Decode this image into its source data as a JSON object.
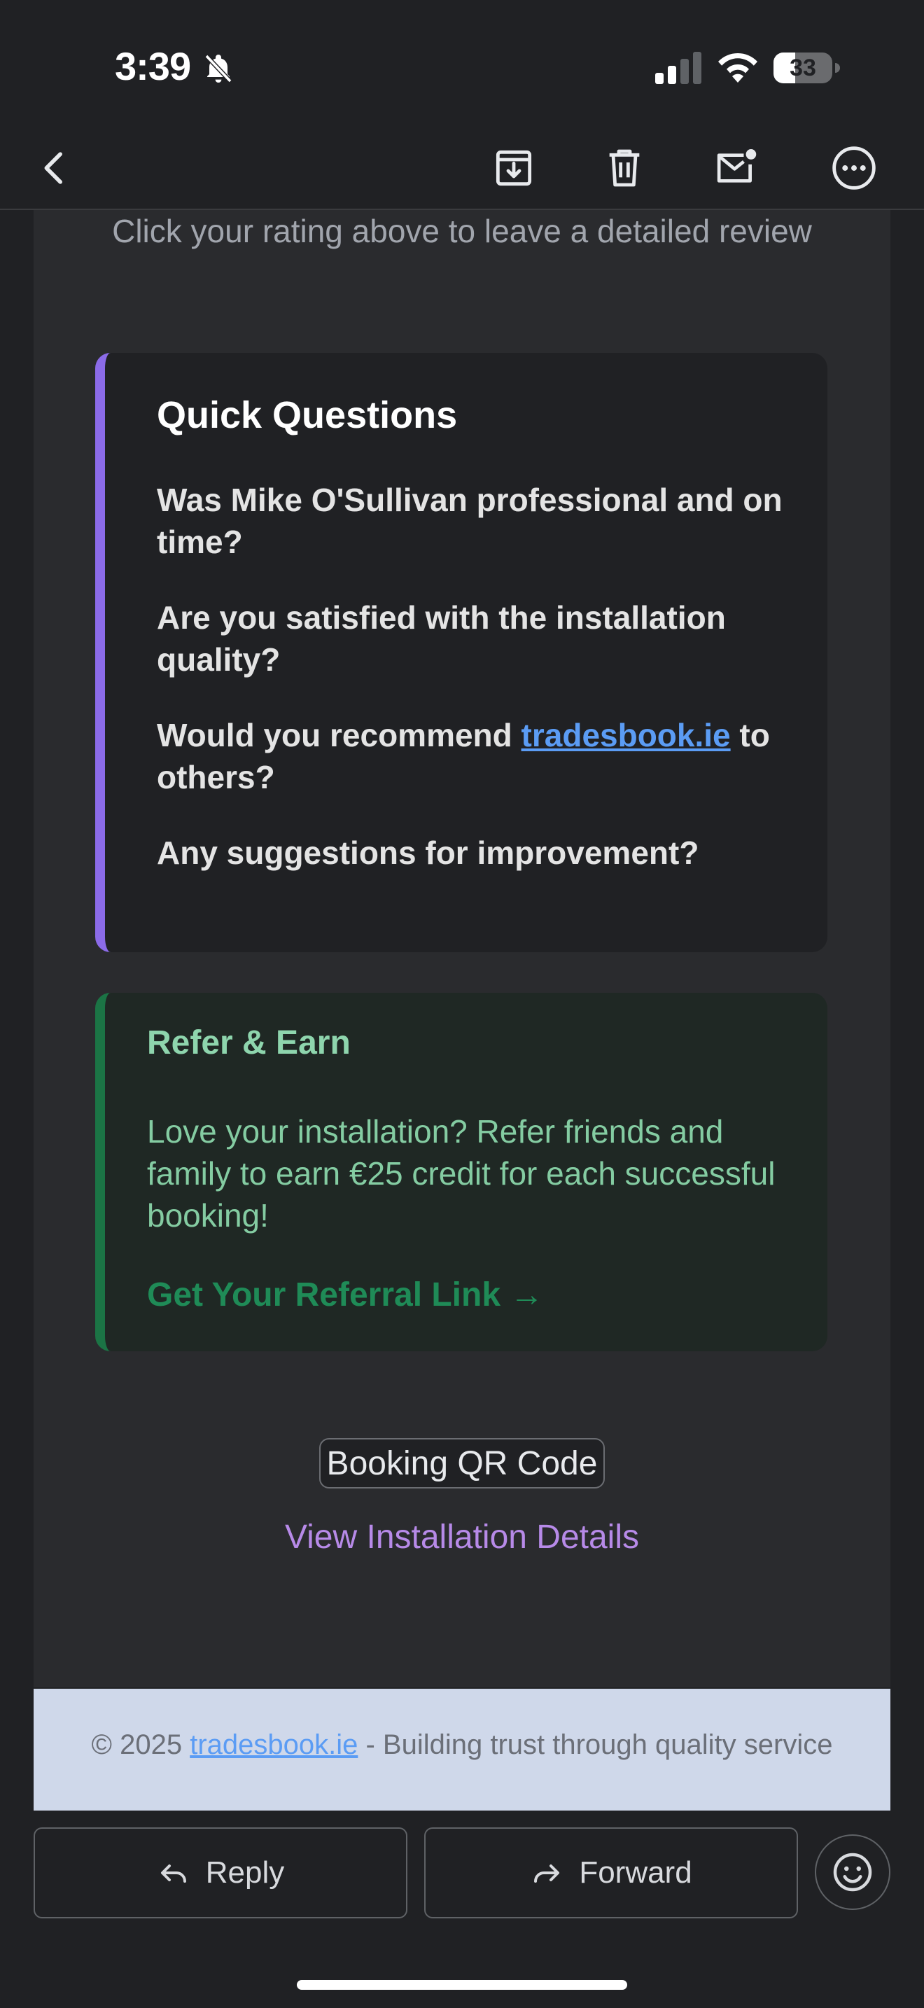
{
  "status_bar": {
    "time": "3:39",
    "battery_level": "33",
    "icons": [
      "bell-off-icon",
      "cellular-signal-icon",
      "wifi-icon",
      "battery-icon"
    ]
  },
  "toolbar": {
    "icons": [
      "back-icon",
      "archive-icon",
      "trash-icon",
      "mark-unread-icon",
      "more-icon"
    ]
  },
  "email": {
    "review_hint": "Click your rating above to leave a detailed review",
    "quick_questions": {
      "title": "Quick Questions",
      "q1": "Was Mike O'Sullivan professional and on time?",
      "q2": "Are you satisfied with the installation quality?",
      "q3_before": "Would you recommend ",
      "q3_link": "tradesbook.ie",
      "q3_after": " to others?",
      "q4": "Any suggestions for improvement?"
    },
    "refer": {
      "title": "Refer & Earn",
      "text": "Love your installation? Refer friends and family to earn €25 credit for each successful booking!",
      "link": "Get Your Referral Link →"
    },
    "qr_button": "Booking QR Code",
    "details_link": "View Installation Details",
    "footer": {
      "prefix": "© 2025 ",
      "link": "tradesbook.ie",
      "suffix": " - Building trust through quality service"
    }
  },
  "actions": {
    "reply": "Reply",
    "forward": "Forward"
  },
  "colors": {
    "background": "#202124",
    "panel": "#2a2b2e",
    "accent_purple": "#8b6be8",
    "accent_green": "#1b7445",
    "link_blue": "#5b9cf4"
  }
}
